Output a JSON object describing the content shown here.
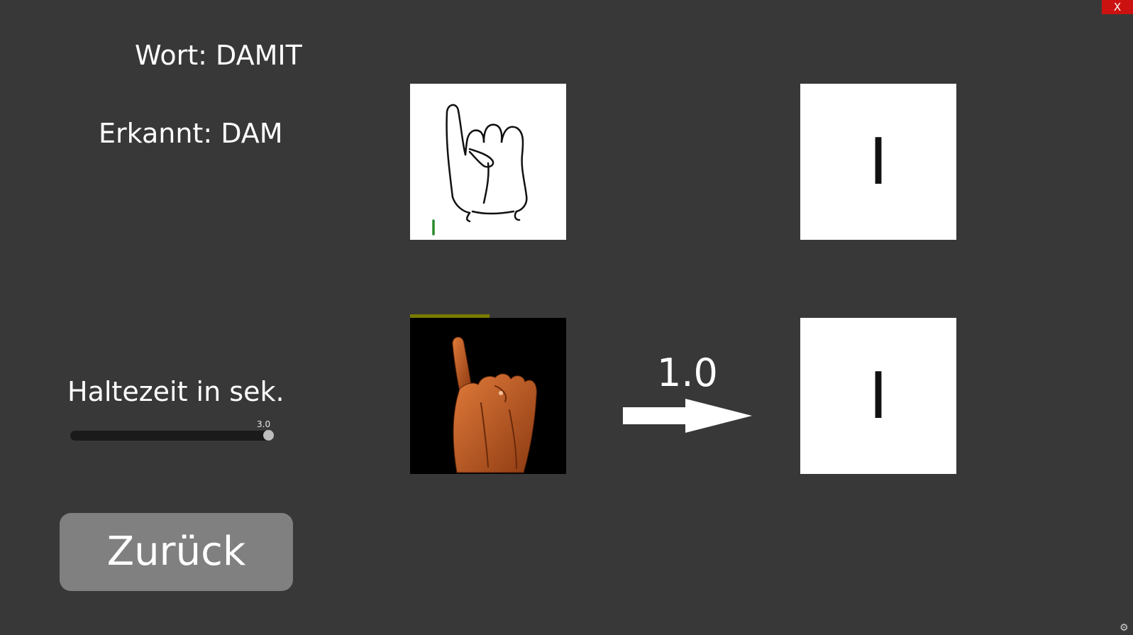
{
  "window": {
    "close_label": "X"
  },
  "left_panel": {
    "word_label": "Wort: DAMIT",
    "recognized_label": "Erkannt: DAM",
    "hold_time_label": "Haltezeit in sek.",
    "hold_slider": {
      "value": 3.0,
      "value_text": "3.0",
      "max_fraction": 1.0
    },
    "back_button_label": "Zurück"
  },
  "target_letter": "I",
  "detected_letter": "I",
  "hold_progress_fraction": 0.51,
  "countdown_text": "1.0",
  "icons": {
    "reference_image": "hand-sign-i-drawing",
    "camera_image": "camera-hand-feed",
    "arrow": "right-arrow-icon",
    "settings": "gear-icon"
  },
  "colors": {
    "background": "#383838",
    "button": "#808080",
    "close": "#cc1111",
    "progress": "#7a7a00"
  }
}
